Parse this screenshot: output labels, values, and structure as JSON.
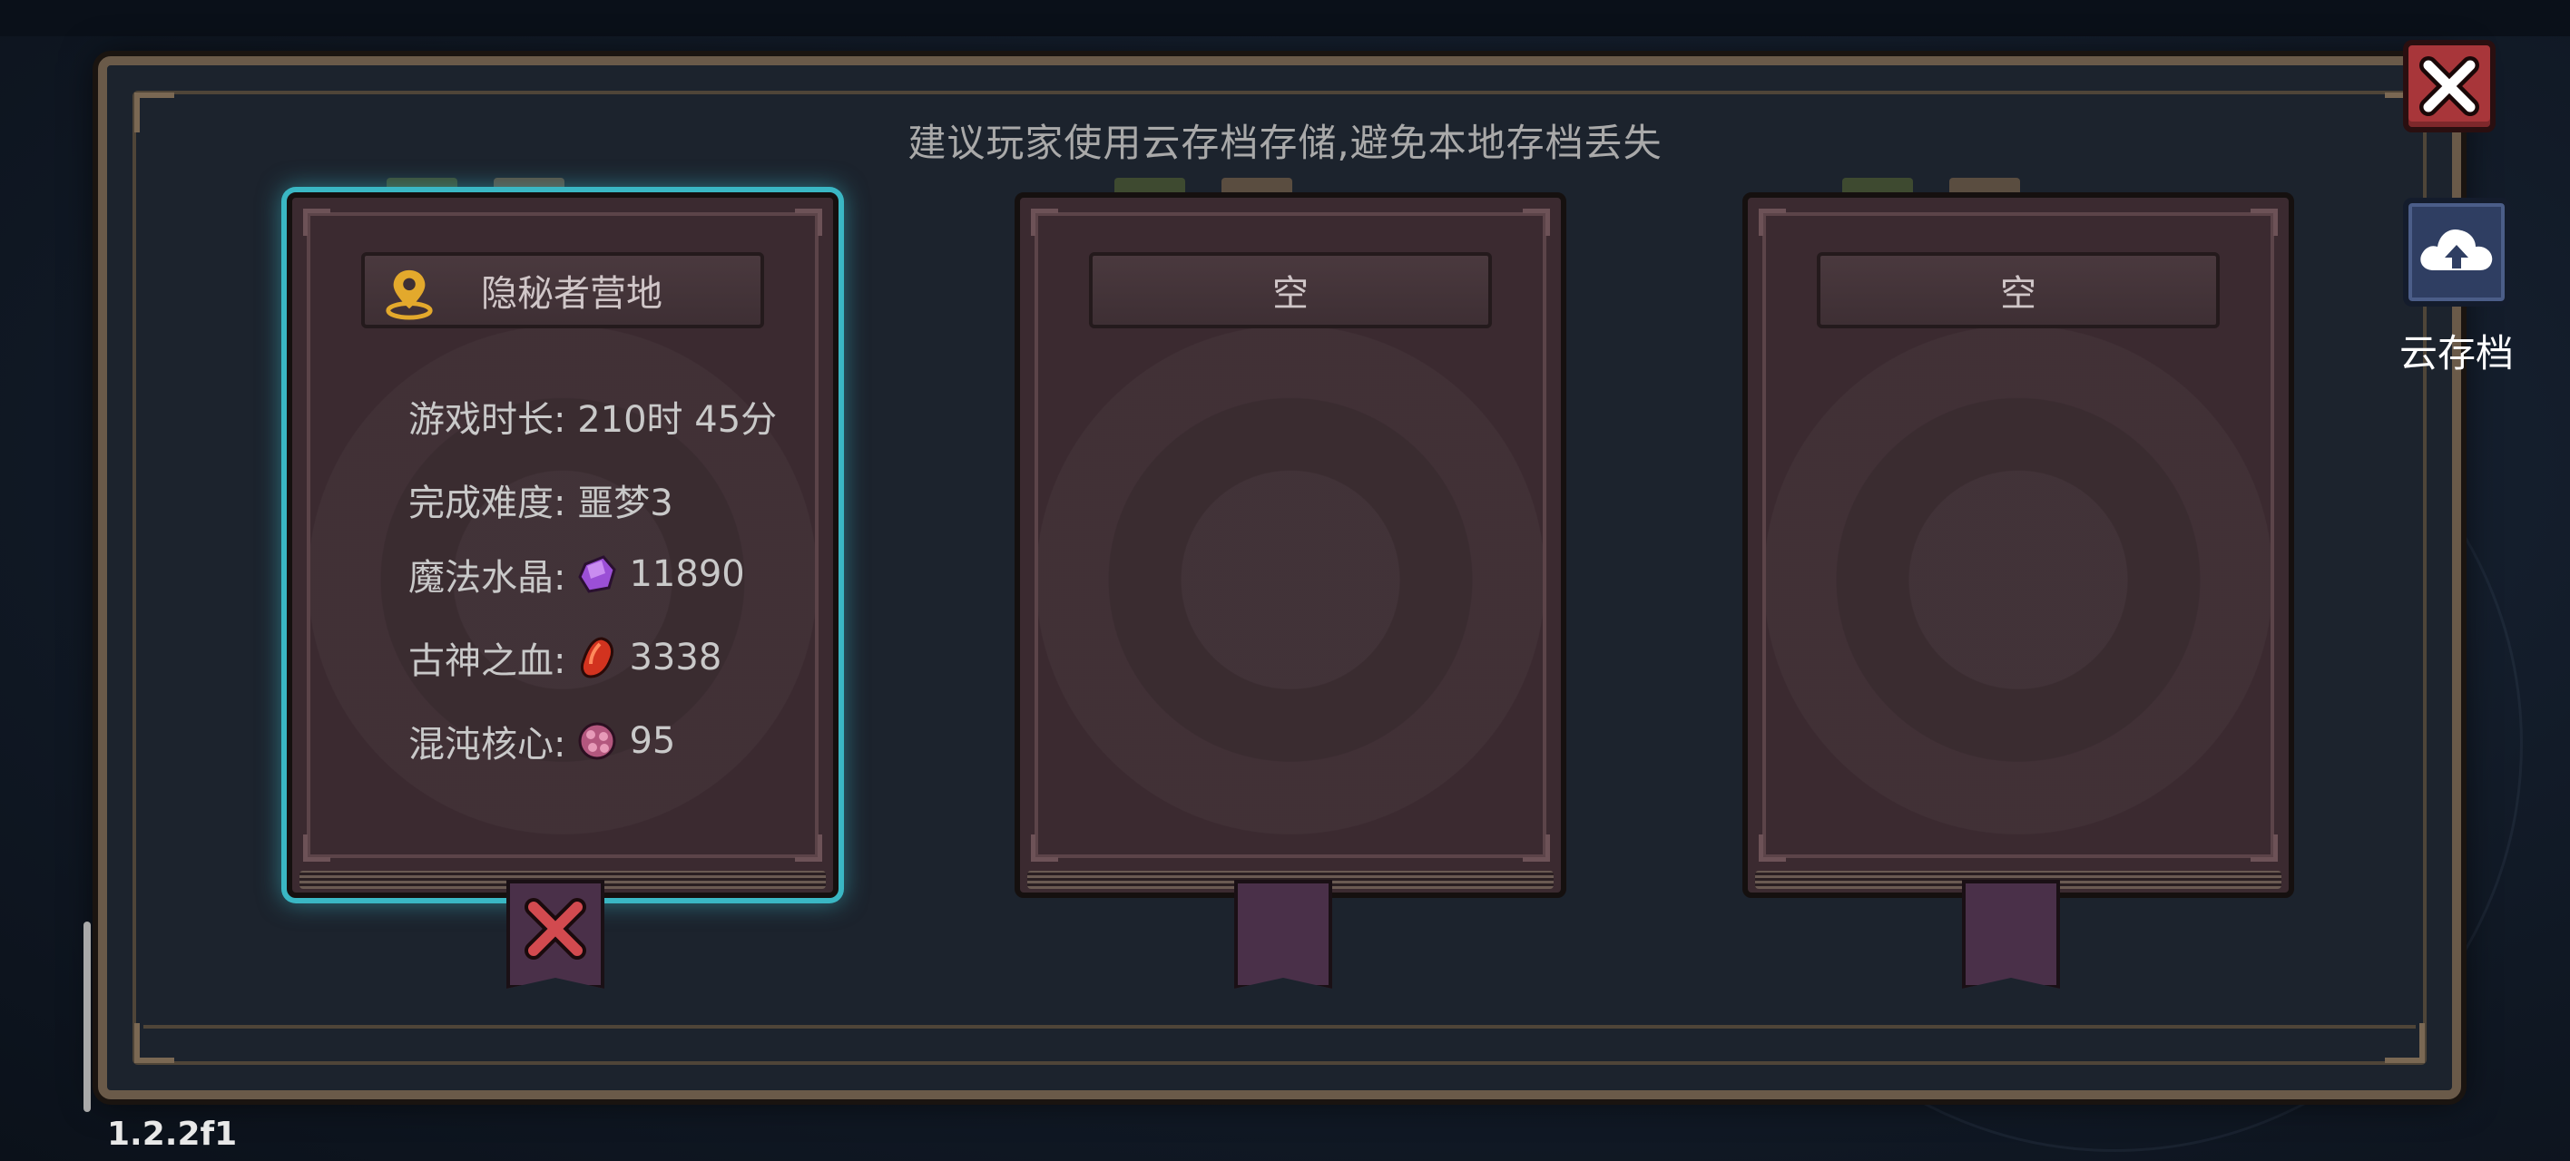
{
  "hint_text": "建议玩家使用云存档存储,避免本地存档丢失",
  "slots": [
    {
      "title": "隐秘者营地",
      "selected": true,
      "stats": {
        "play_time": "游戏时长: 210时 45分",
        "difficulty": "完成难度: 噩梦3",
        "crystal_label": "魔法水晶:",
        "crystal_value": "11890",
        "blood_label": "古神之血:",
        "blood_value": "3338",
        "chaos_label": "混沌核心:",
        "chaos_value": "95"
      }
    },
    {
      "title": "空",
      "selected": false
    },
    {
      "title": "空",
      "selected": false
    }
  ],
  "cloud_save_label": "云存档",
  "version": "1.2.2f1",
  "colors": {
    "selected_glow": "#3ab7c4",
    "close_button": "#a8363a",
    "cloud_button": "#2f3e62",
    "book": "#3b2a30"
  },
  "icons": {
    "location": "location-pin-icon",
    "crystal": "purple-crystal-icon",
    "blood": "red-blood-gem-icon",
    "chaos": "chaos-core-icon",
    "close": "close-x-icon",
    "cloud": "cloud-upload-icon",
    "delete": "delete-x-icon"
  }
}
